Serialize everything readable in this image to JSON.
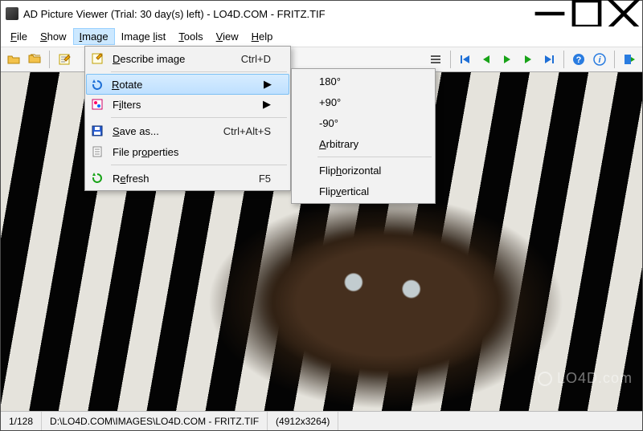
{
  "title": "AD Picture Viewer (Trial: 30 day(s) left) - LO4D.COM - FRITZ.TIF",
  "menubar": {
    "file": "File",
    "show": "Show",
    "image": "Image",
    "image_list": "Image list",
    "tools": "Tools",
    "view": "View",
    "help": "Help"
  },
  "image_menu": {
    "describe": "Describe image",
    "describe_shortcut": "Ctrl+D",
    "rotate": "Rotate",
    "filters": "Filters",
    "save_as": "Save as...",
    "save_as_shortcut": "Ctrl+Alt+S",
    "file_properties": "File properties",
    "refresh": "Refresh",
    "refresh_shortcut": "F5"
  },
  "rotate_submenu": {
    "r180": "180°",
    "rp90": "+90°",
    "rm90": "-90°",
    "arbitrary": "Arbitrary",
    "flip_h": "Flip horizontal",
    "flip_v": "Flip vertical"
  },
  "status": {
    "counter": "1/128",
    "path": "D:\\LO4D.COM\\IMAGES\\LO4D.COM - FRITZ.TIF",
    "dimensions": "(4912x3264)"
  },
  "watermark": "LO4D.com"
}
